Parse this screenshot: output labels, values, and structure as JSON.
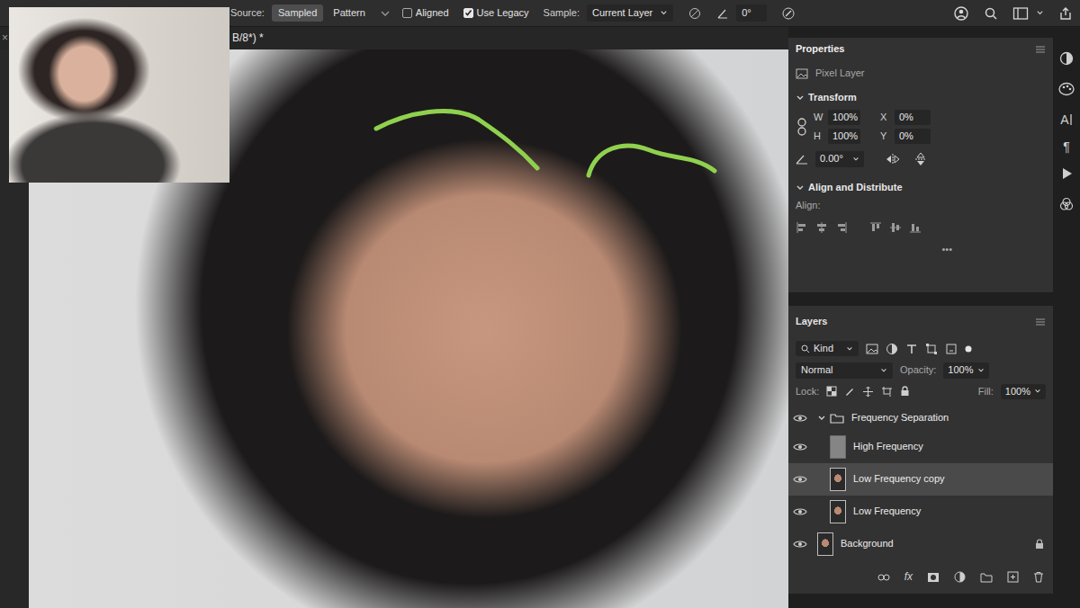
{
  "options_bar": {
    "source_label": "Source:",
    "source_modes": [
      {
        "label": "Sampled",
        "selected": true
      },
      {
        "label": "Pattern",
        "selected": false
      }
    ],
    "checkboxes": [
      {
        "label": "Aligned",
        "checked": false
      },
      {
        "label": "Use Legacy",
        "checked": true
      }
    ],
    "sample_label": "Sample:",
    "sample_value": "Current Layer",
    "angle": "0°"
  },
  "document_tab": {
    "close": "×",
    "title": "B/8*) *"
  },
  "properties": {
    "title": "Properties",
    "layer_kind": "Pixel Layer",
    "transform": {
      "title": "Transform",
      "expanded": true,
      "fields": [
        {
          "label": "W",
          "value": "100%"
        },
        {
          "label": "X",
          "value": "0%"
        },
        {
          "label": "H",
          "value": "100%"
        },
        {
          "label": "Y",
          "value": "0%"
        }
      ],
      "angle": "0.00°"
    },
    "align": {
      "title": "Align and Distribute",
      "expanded": true,
      "label": "Align:",
      "more": "•••"
    }
  },
  "layers": {
    "title": "Layers",
    "filter": "Kind",
    "blend_mode": "Normal",
    "opacity_label": "Opacity:",
    "opacity": "100%",
    "lock_label": "Lock:",
    "fill_label": "Fill:",
    "fill": "100%",
    "footer_fx": "fx",
    "items": [
      {
        "name": "Frequency Separation",
        "kind": "group",
        "visible": true,
        "expanded": true,
        "selected": false,
        "locked": false,
        "children": [
          {
            "name": "High Frequency",
            "kind": "gray",
            "visible": true,
            "selected": false,
            "locked": false
          },
          {
            "name": "Low Frequency copy",
            "kind": "photo",
            "visible": true,
            "selected": true,
            "locked": false
          },
          {
            "name": "Low Frequency",
            "kind": "photo",
            "visible": true,
            "selected": false,
            "locked": false
          }
        ]
      },
      {
        "name": "Background",
        "kind": "photo",
        "visible": true,
        "selected": false,
        "locked": true
      }
    ]
  },
  "tool_strip": {
    "character_glyph": "A",
    "paragraph_glyph": "¶"
  }
}
